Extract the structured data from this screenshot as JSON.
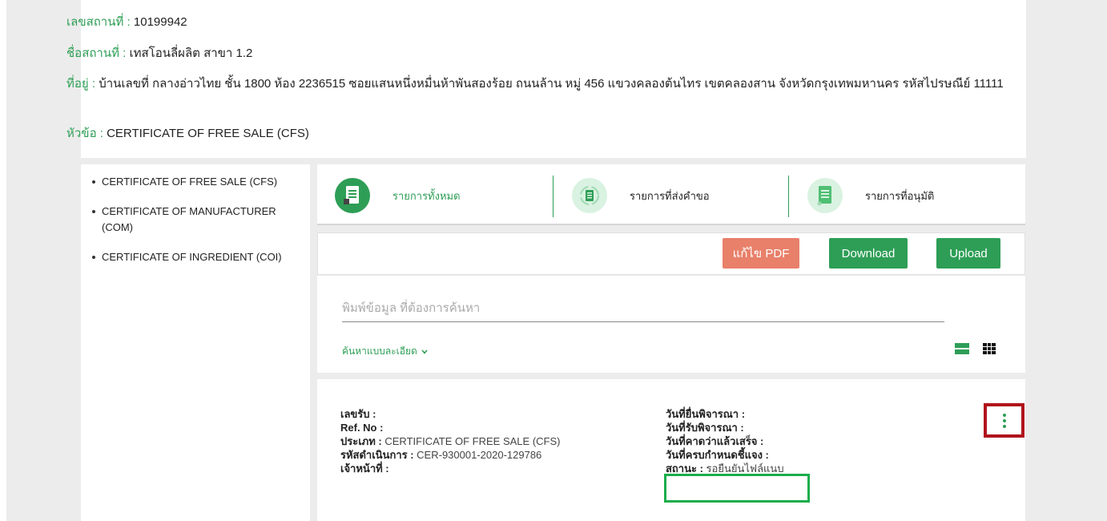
{
  "establishment": {
    "number_label": "เลขสถานที่ :",
    "number_value": "10199942",
    "name_label": "ชื่อสถานที่ :",
    "name_value": "เทสโอนลี่ผลิต สาขา 1.2",
    "address_label": "ที่อยู่ :",
    "address_value": "บ้านเลขที่ กลางอ่าวไทย ชั้น 1800 ห้อง 2236515 ซอยแสนหนึ่งหมื่นห้าพันสองร้อย ถนนล้าน หมู่ 456 แขวงคลองต้นไทร เขตคลองสาน จังหวัดกรุงเทพมหานคร รหัสไปรษณีย์ 11111",
    "topic_label": "หัวข้อ :",
    "topic_value": "CERTIFICATE OF FREE SALE (CFS)"
  },
  "categories": [
    "CERTIFICATE OF FREE SALE (CFS)",
    "CERTIFICATE OF MANUFACTURER (COM)",
    "CERTIFICATE OF INGREDIENT (COI)"
  ],
  "tabs": [
    {
      "label": "รายการทั้งหมด",
      "icon": "document-icon",
      "active": true
    },
    {
      "label": "รายการที่ส่งคำขอ",
      "icon": "document-refresh-icon",
      "active": false
    },
    {
      "label": "รายการที่อนุมัติ",
      "icon": "document-approved-icon",
      "active": false
    }
  ],
  "actions": {
    "edit_pdf": "แก้ไข PDF",
    "download": "Download",
    "upload": "Upload"
  },
  "search": {
    "placeholder": "พิมพ์ข้อมูล ที่ต้องการค้นหา",
    "advanced_label": "ค้นหาแบบละเอียด"
  },
  "record": {
    "receipt_no_label": "เลขรับ :",
    "receipt_no_value": "",
    "ref_no_label": "Ref. No :",
    "ref_no_value": "",
    "type_label": "ประเภท :",
    "type_value": "CERTIFICATE OF FREE SALE (CFS)",
    "process_code_label": "รหัสดำเนินการ :",
    "process_code_value": "CER-930001-2020-129786",
    "officer_label": "เจ้าหน้าที่ :",
    "officer_value": "",
    "submit_date_label": "วันที่ยื่นพิจารณา :",
    "submit_date_value": "",
    "receive_date_label": "วันที่รับพิจารณา :",
    "receive_date_value": "",
    "expected_date_label": "วันที่คาดว่าแล้วเสร็จ :",
    "expected_date_value": "",
    "clarify_due_label": "วันที่ครบกำหนดชี้แจง :",
    "clarify_due_value": "",
    "status_label": "สถานะ :",
    "status_value": "รอยืนยันไฟล์แนบ"
  },
  "colors": {
    "accent": "#2e9e56",
    "edit_pdf": "#e8806a",
    "highlight_green": "#1aad4a",
    "highlight_red": "#b0141b"
  }
}
